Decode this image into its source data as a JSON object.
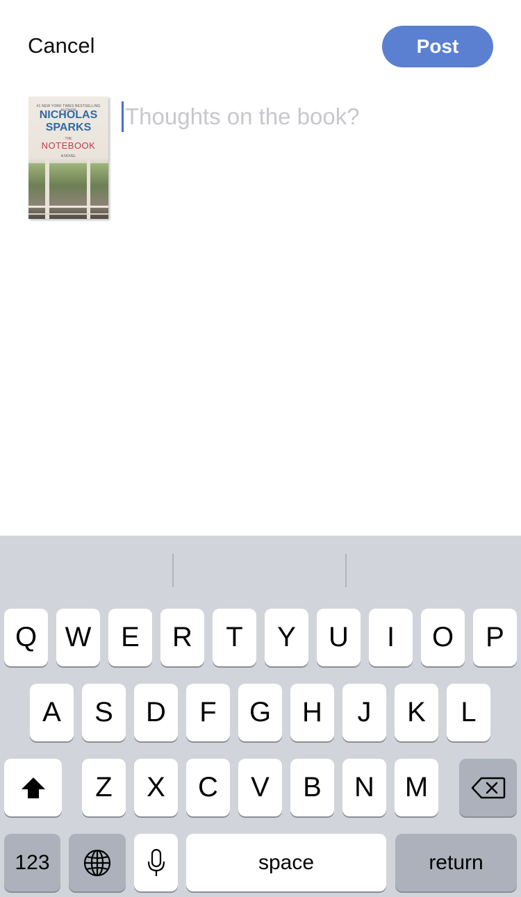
{
  "header": {
    "cancel_label": "Cancel",
    "post_label": "Post"
  },
  "book": {
    "tag": "#1 NEW YORK TIMES BESTSELLING AUTHOR",
    "author_line1": "NICHOLAS",
    "author_line2": "SPARKS",
    "the": "THE",
    "title": "NOTEBOOK",
    "novel": "A NOVEL"
  },
  "composer": {
    "placeholder": "Thoughts on the book?"
  },
  "keyboard": {
    "row1": [
      "Q",
      "W",
      "E",
      "R",
      "T",
      "Y",
      "U",
      "I",
      "O",
      "P"
    ],
    "row2": [
      "A",
      "S",
      "D",
      "F",
      "G",
      "H",
      "J",
      "K",
      "L"
    ],
    "row3": [
      "Z",
      "X",
      "C",
      "V",
      "B",
      "N",
      "M"
    ],
    "numbers_label": "123",
    "space_label": "space",
    "return_label": "return",
    "icons": [
      "shift-icon",
      "backspace-icon",
      "globe-icon",
      "microphone-icon"
    ]
  },
  "colors": {
    "accent": "#5b80d2",
    "caret": "#4a6cd4",
    "keyboard_bg": "#d1d4da",
    "key_dark": "#acb1bb"
  }
}
